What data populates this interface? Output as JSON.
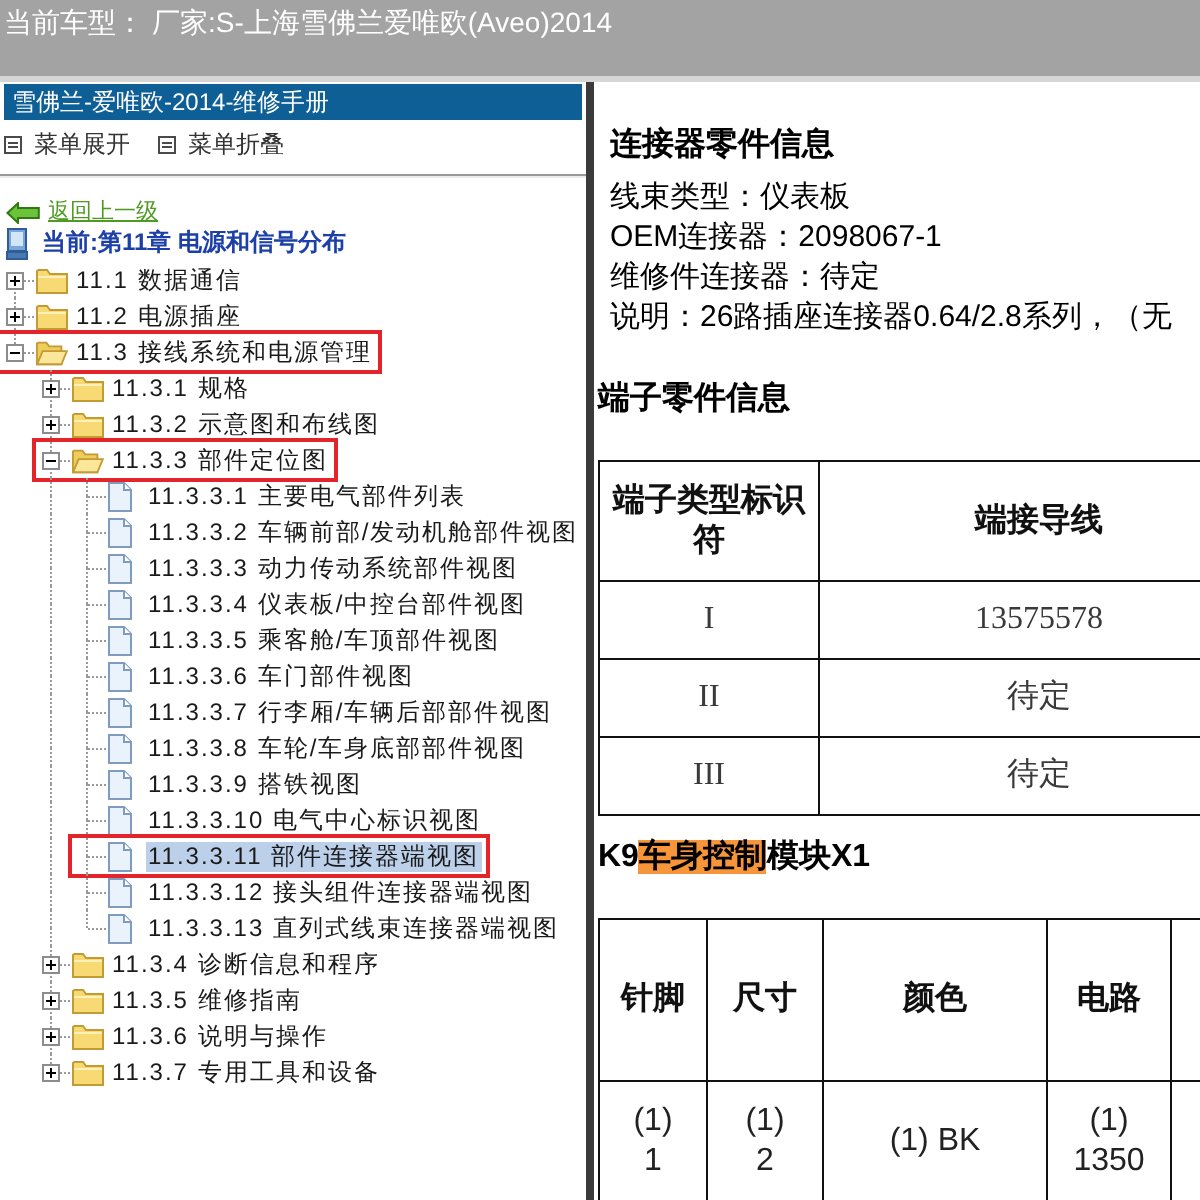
{
  "header": {
    "label": "当前车型：",
    "value": "厂家:S-上海雪佛兰爱唯欧(Aveo)2014"
  },
  "sidebar": {
    "title": "雪佛兰-爱唯欧-2014-维修手册",
    "menu_actions": [
      "菜单展开",
      "菜单折叠"
    ],
    "back_link": "返回上一级",
    "current_chapter": "当前:第11章 电源和信号分布",
    "tree": [
      {
        "label": "11.1 数据通信",
        "kind": "folder",
        "expanded": false,
        "selected": false,
        "outlined": false
      },
      {
        "label": "11.2 电源插座",
        "kind": "folder",
        "expanded": false,
        "selected": false,
        "outlined": false
      },
      {
        "label": "11.3 接线系统和电源管理",
        "kind": "folder",
        "expanded": true,
        "selected": false,
        "outlined": true,
        "children": [
          {
            "label": "11.3.1 规格",
            "kind": "folder",
            "expanded": false,
            "selected": false,
            "outlined": false
          },
          {
            "label": "11.3.2 示意图和布线图",
            "kind": "folder",
            "expanded": false,
            "selected": false,
            "outlined": false
          },
          {
            "label": "11.3.3 部件定位图",
            "kind": "folder",
            "expanded": true,
            "selected": false,
            "outlined": true,
            "children": [
              {
                "label": "11.3.3.1 主要电气部件列表",
                "kind": "page",
                "selected": false,
                "outlined": false
              },
              {
                "label": "11.3.3.2 车辆前部/发动机舱部件视图",
                "kind": "page",
                "selected": false,
                "outlined": false
              },
              {
                "label": "11.3.3.3 动力传动系统部件视图",
                "kind": "page",
                "selected": false,
                "outlined": false
              },
              {
                "label": "11.3.3.4 仪表板/中控台部件视图",
                "kind": "page",
                "selected": false,
                "outlined": false
              },
              {
                "label": "11.3.3.5 乘客舱/车顶部件视图",
                "kind": "page",
                "selected": false,
                "outlined": false
              },
              {
                "label": "11.3.3.6 车门部件视图",
                "kind": "page",
                "selected": false,
                "outlined": false
              },
              {
                "label": "11.3.3.7 行李厢/车辆后部部件视图",
                "kind": "page",
                "selected": false,
                "outlined": false
              },
              {
                "label": "11.3.3.8 车轮/车身底部部件视图",
                "kind": "page",
                "selected": false,
                "outlined": false
              },
              {
                "label": "11.3.3.9 搭铁视图",
                "kind": "page",
                "selected": false,
                "outlined": false
              },
              {
                "label": "11.3.3.10 电气中心标识视图",
                "kind": "page",
                "selected": false,
                "outlined": false
              },
              {
                "label": "11.3.3.11 部件连接器端视图",
                "kind": "page",
                "selected": true,
                "outlined": true
              },
              {
                "label": "11.3.3.12 接头组件连接器端视图",
                "kind": "page",
                "selected": false,
                "outlined": false
              },
              {
                "label": "11.3.3.13 直列式线束连接器端视图",
                "kind": "page",
                "selected": false,
                "outlined": false
              }
            ]
          },
          {
            "label": "11.3.4 诊断信息和程序",
            "kind": "folder",
            "expanded": false,
            "selected": false,
            "outlined": false
          },
          {
            "label": "11.3.5 维修指南",
            "kind": "folder",
            "expanded": false,
            "selected": false,
            "outlined": false
          },
          {
            "label": "11.3.6 说明与操作",
            "kind": "folder",
            "expanded": false,
            "selected": false,
            "outlined": false
          },
          {
            "label": "11.3.7 专用工具和设备",
            "kind": "folder",
            "expanded": false,
            "selected": false,
            "outlined": false
          }
        ]
      }
    ]
  },
  "content": {
    "connector_info": {
      "title": "连接器零件信息",
      "lines": [
        "线束类型：仪表板",
        "OEM连接器：2098067-1",
        "维修件连接器：待定",
        "说明：26路插座连接器0.64/2.8系列，（无"
      ]
    },
    "terminal_info": {
      "title": "端子零件信息",
      "table": {
        "columns": [
          "端子类型标识符",
          "端接导线"
        ],
        "rows": [
          [
            "I",
            "13575578"
          ],
          [
            "II",
            "待定"
          ],
          [
            "III",
            "待定"
          ]
        ]
      }
    },
    "pinout": {
      "title": [
        {
          "text": "K9",
          "highlighted": false
        },
        {
          "text": "车身控制",
          "highlighted": true
        },
        {
          "text": "模块X1",
          "highlighted": false
        }
      ],
      "table": {
        "columns": [
          "针脚",
          "尺寸",
          "颜色",
          "电路"
        ],
        "rows": [
          [
            "(1)\n1",
            "(1)\n2",
            "(1) BK",
            "(1)\n1350"
          ]
        ]
      }
    }
  }
}
